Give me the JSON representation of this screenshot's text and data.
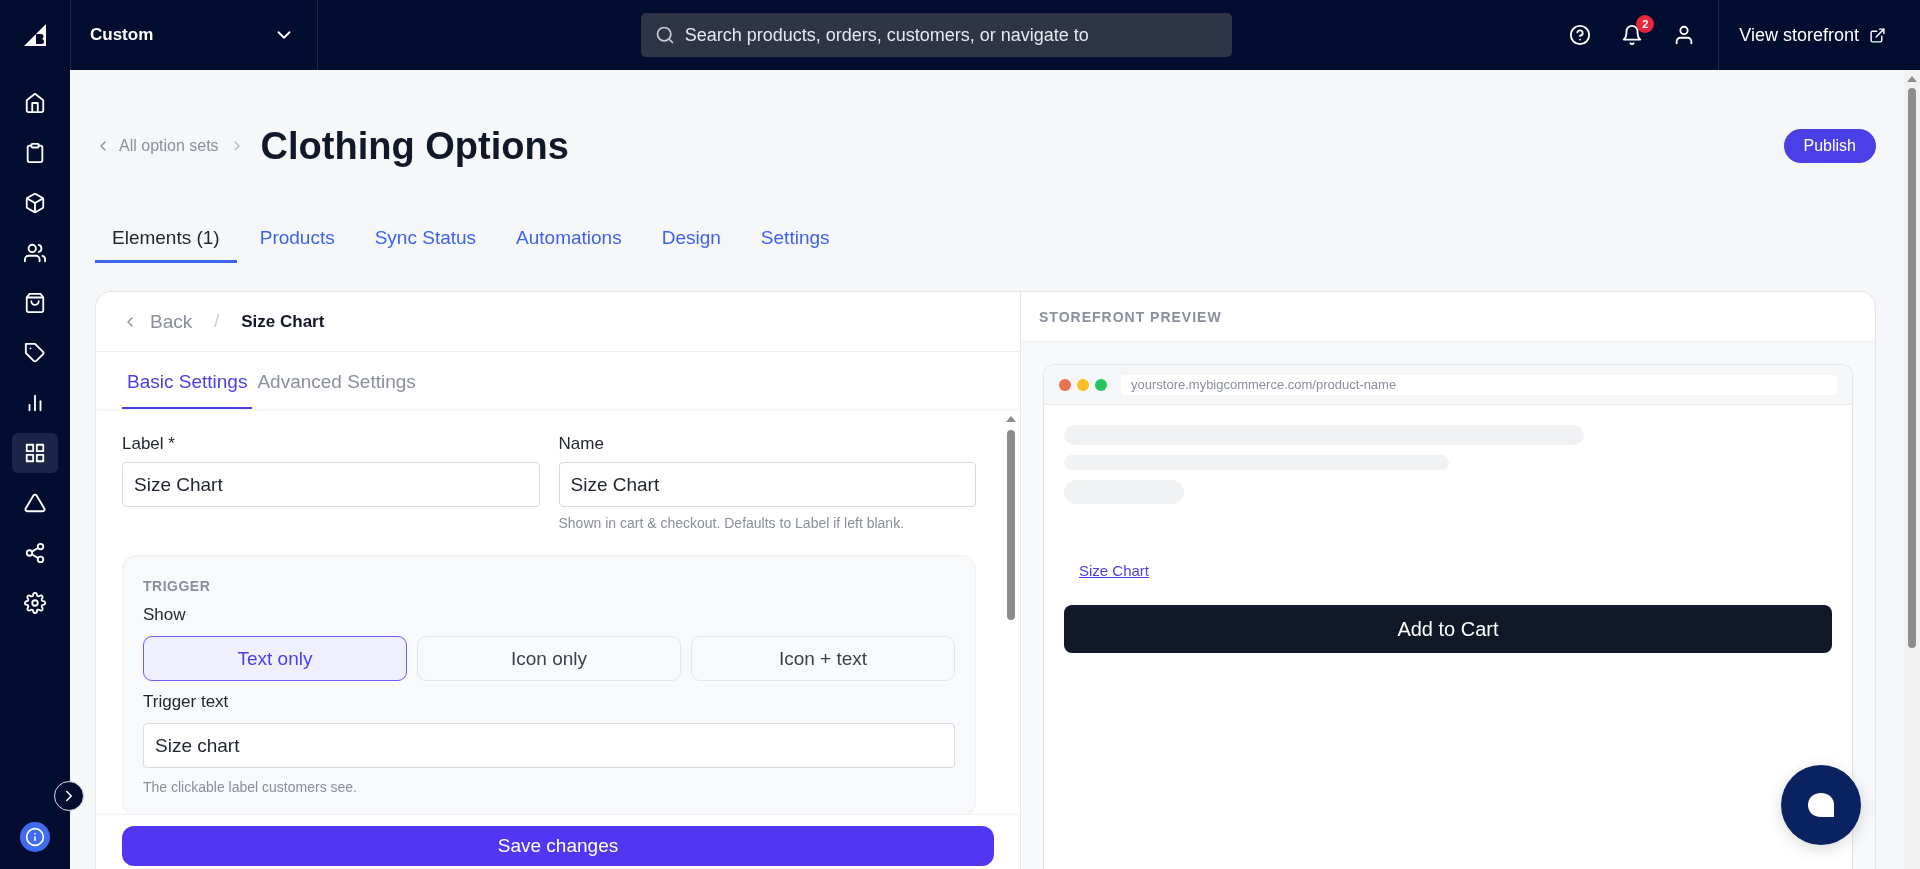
{
  "topbar": {
    "store_selector": "Custom",
    "search": {
      "placeholder": "Search products, orders, customers, or navigate to"
    },
    "notification_count": "2",
    "view_storefront": "View storefront"
  },
  "sidebar": {
    "items": [
      {
        "kind": "home",
        "selected": false
      },
      {
        "kind": "orders",
        "selected": false
      },
      {
        "kind": "products",
        "selected": false
      },
      {
        "kind": "customers",
        "selected": false
      },
      {
        "kind": "storefront",
        "selected": false
      },
      {
        "kind": "marketing",
        "selected": false
      },
      {
        "kind": "analytics",
        "selected": false
      },
      {
        "kind": "apps",
        "selected": true
      },
      {
        "kind": "channels",
        "selected": false
      },
      {
        "kind": "network",
        "selected": false
      },
      {
        "kind": "settings",
        "selected": false
      }
    ]
  },
  "breadcrumb": "All option sets",
  "title": "Clothing Options",
  "publish": "Publish",
  "tabs": [
    {
      "label": "Elements (1)",
      "selected": true
    },
    {
      "label": "Products",
      "selected": false
    },
    {
      "label": "Sync Status",
      "selected": false
    },
    {
      "label": "Automations",
      "selected": false
    },
    {
      "label": "Design",
      "selected": false
    },
    {
      "label": "Settings",
      "selected": false
    }
  ],
  "editor": {
    "back": "Back",
    "separator": "/",
    "crumb": "Size Chart",
    "tabs": [
      {
        "label": "Basic Settings",
        "selected": true
      },
      {
        "label": "Advanced Settings",
        "selected": false
      }
    ],
    "fields": [
      {
        "label": "Label *",
        "value": "Size Chart"
      },
      {
        "label": "Name",
        "value": "Size Chart",
        "hint": "Shown in cart & checkout. Defaults to Label if left blank."
      }
    ],
    "trigger": {
      "heading": "TRIGGER",
      "show_label": "Show",
      "options": [
        {
          "label": "Text only",
          "selected": true
        },
        {
          "label": "Icon only",
          "selected": false
        },
        {
          "label": "Icon + text",
          "selected": false
        }
      ],
      "text_label": "Trigger text",
      "text_value": "Size chart",
      "hint": "The clickable label customers see."
    },
    "save": "Save changes"
  },
  "preview": {
    "heading": "STOREFRONT PREVIEW",
    "url": "yourstore.mybigcommerce.com/product-name",
    "link": "Size Chart",
    "add_to_cart": "Add to Cart"
  }
}
